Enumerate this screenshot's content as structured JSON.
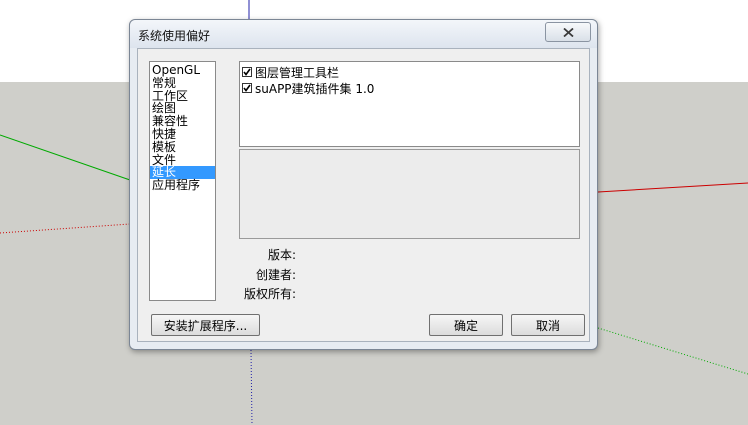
{
  "dialog": {
    "title": "系统使用偏好",
    "categories": [
      {
        "label": "OpenGL",
        "selected": false
      },
      {
        "label": "常规",
        "selected": false
      },
      {
        "label": "工作区",
        "selected": false
      },
      {
        "label": "绘图",
        "selected": false
      },
      {
        "label": "兼容性",
        "selected": false
      },
      {
        "label": "快捷",
        "selected": false
      },
      {
        "label": "模板",
        "selected": false
      },
      {
        "label": "文件",
        "selected": false
      },
      {
        "label": "延长",
        "selected": true
      },
      {
        "label": "应用程序",
        "selected": false
      }
    ],
    "extensions": [
      {
        "label": "图层管理工具栏",
        "checked": true
      },
      {
        "label": "suAPP建筑插件集 1.0",
        "checked": true
      }
    ],
    "info": {
      "version_label": "版本:",
      "creator_label": "创建者:",
      "copyright_label": "版权所有:"
    },
    "buttons": {
      "install_label": "安装扩展程序...",
      "ok_label": "确定",
      "cancel_label": "取消"
    }
  },
  "colors": {
    "selection": "#3399ff",
    "ground": "#cfcfca",
    "sky": "#ffffff",
    "axis_red": "#cc0000",
    "axis_green": "#00aa00",
    "axis_blue": "#2020aa"
  },
  "icons": {
    "close": "close-x-icon",
    "check": "checkmark-icon"
  }
}
